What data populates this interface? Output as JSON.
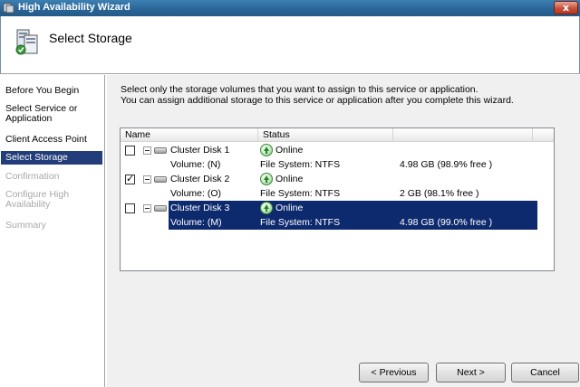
{
  "window": {
    "title": "High Availability Wizard",
    "close_glyph": "x"
  },
  "header": {
    "title": "Select Storage",
    "icon": "cluster-storage-icon"
  },
  "nav": {
    "items": [
      {
        "label": "Before You Begin",
        "state": "normal"
      },
      {
        "label": "Select Service or\nApplication",
        "state": "normal"
      },
      {
        "label": "Client Access Point",
        "state": "normal"
      },
      {
        "label": "Select Storage",
        "state": "active"
      },
      {
        "label": "Confirmation",
        "state": "disabled"
      },
      {
        "label": "Configure High\nAvailability",
        "state": "disabled"
      },
      {
        "label": "Summary",
        "state": "disabled"
      }
    ]
  },
  "content": {
    "description_line1": "Select only the storage volumes that you want to assign to this service or application.",
    "description_line2": "You can assign additional storage to this service or application after you complete this wizard.",
    "columns": [
      "Name",
      "Status",
      ""
    ],
    "disks": [
      {
        "name": "Cluster Disk 1",
        "checked": false,
        "selected": false,
        "status": "Online",
        "volume": "Volume: (N)",
        "filesystem": "File System: NTFS",
        "size": "4.98 GB (98.9% free )"
      },
      {
        "name": "Cluster Disk 2",
        "checked": true,
        "selected": false,
        "status": "Online",
        "volume": "Volume: (O)",
        "filesystem": "File System: NTFS",
        "size": "2 GB (98.1% free )"
      },
      {
        "name": "Cluster Disk 3",
        "checked": false,
        "selected": true,
        "status": "Online",
        "volume": "Volume: (M)",
        "filesystem": "File System: NTFS",
        "size": "4.98 GB (99.0% free )"
      }
    ]
  },
  "buttons": {
    "previous": "< Previous",
    "next": "Next >",
    "cancel": "Cancel"
  },
  "colors": {
    "selection": "#0e2a6e",
    "nav_active": "#233d7a",
    "titlebar": "#2a6496",
    "online_green": "#1d8a1d"
  }
}
